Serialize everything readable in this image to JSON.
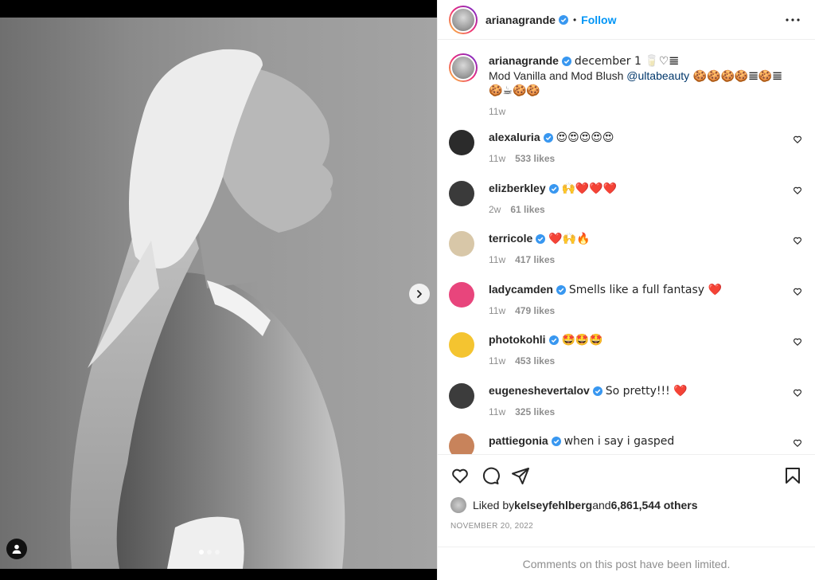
{
  "header": {
    "username": "arianagrande",
    "separator": "•",
    "follow_label": "Follow"
  },
  "caption": {
    "username": "arianagrande",
    "line1": "december 1 🥛♡𝌆",
    "line2_prefix": "Mod Vanilla and Mod Blush ",
    "mention": "@ultabeauty",
    "line2_suffix": " 🍪🍪🍪🍪𝌆🍪𝌆",
    "line3": "🍪☕🍪🍪",
    "time": "11w"
  },
  "comments": [
    {
      "username": "alexaluria",
      "verified": true,
      "text": "😍😍😍😍😍",
      "time": "11w",
      "likes": "533 likes",
      "avatar_color": "#2b2b2b"
    },
    {
      "username": "elizberkley",
      "verified": true,
      "text": "🙌❤️❤️❤️",
      "time": "2w",
      "likes": "61 likes",
      "avatar_color": "#3a3a3a"
    },
    {
      "username": "terricole",
      "verified": true,
      "text": "❤️🙌🔥",
      "time": "11w",
      "likes": "417 likes",
      "avatar_color": "#d8c7a8"
    },
    {
      "username": "ladycamden",
      "verified": true,
      "text": "Smells like a full fantasy ❤️",
      "time": "11w",
      "likes": "479 likes",
      "avatar_color": "#e8457c"
    },
    {
      "username": "photokohli",
      "verified": true,
      "text": "🤩🤩🤩",
      "time": "11w",
      "likes": "453 likes",
      "avatar_color": "#f4c430"
    },
    {
      "username": "eugeneshevertalov",
      "verified": true,
      "text": "So pretty!!! ❤️",
      "time": "11w",
      "likes": "325 likes",
      "avatar_color": "#3c3c3c"
    },
    {
      "username": "pattiegonia",
      "verified": true,
      "text": "when i say i gasped",
      "time": "",
      "likes": "",
      "avatar_color": "#c8835b"
    }
  ],
  "likes": {
    "prefix": "Liked by ",
    "user": "kelseyfehlberg",
    "middle": " and ",
    "count": "6,861,544 others"
  },
  "date": "NOVEMBER 20, 2022",
  "comments_limited": "Comments on this post have been limited.",
  "colors": {
    "accent": "#0095f6",
    "verified": "#3897f0",
    "muted": "#8e8e8e",
    "text": "#262626"
  },
  "icons": {
    "more": "more-horizontal-icon",
    "like": "heart-outline-icon",
    "comment": "comment-icon",
    "share": "paper-plane-icon",
    "save": "bookmark-icon",
    "next": "chevron-right-icon",
    "tag": "user-tag-icon"
  }
}
